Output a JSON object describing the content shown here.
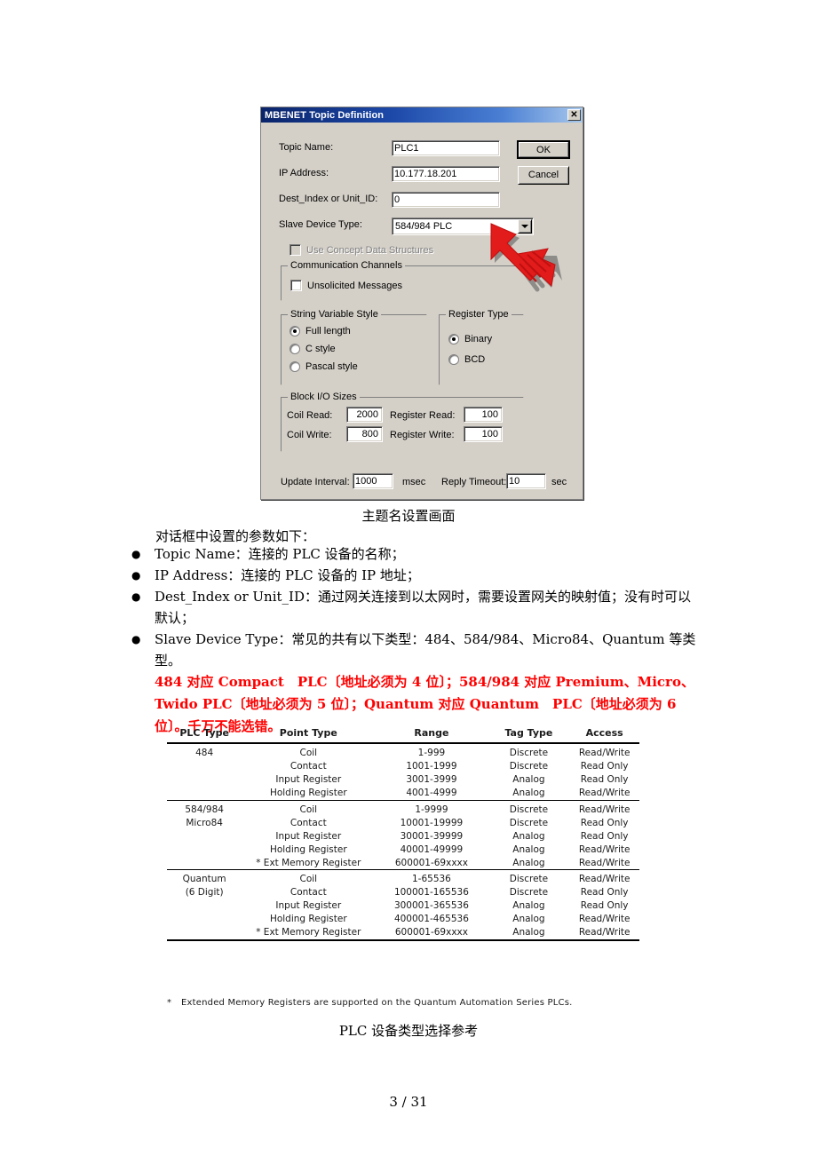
{
  "dialog": {
    "title": "MBENET Topic Definition",
    "close_label": "✕",
    "fields": {
      "topic_name_label": "Topic Name:",
      "topic_name_value": "PLC1",
      "ip_address_label": "IP Address:",
      "ip_address_value": "10.177.18.201",
      "dest_index_label": "Dest_Index or Unit_ID:",
      "dest_index_value": "0",
      "slave_device_label": "Slave Device Type:",
      "slave_device_value": "584/984 PLC"
    },
    "buttons": {
      "ok": "OK",
      "cancel": "Cancel"
    },
    "concept_checkbox": "Use Concept Data Structures",
    "comm_channels": {
      "group_title": "Communication Channels",
      "unsolicited": "Unsolicited Messages"
    },
    "string_style": {
      "group_title": "String Variable Style",
      "options": [
        "Full length",
        "C style",
        "Pascal style"
      ],
      "selected": "Full length"
    },
    "register_type": {
      "group_title": "Register Type",
      "options": [
        "Binary",
        "BCD"
      ],
      "selected": "Binary"
    },
    "block_io": {
      "group_title": "Block I/O Sizes",
      "coil_read_label": "Coil Read:",
      "coil_read_value": "2000",
      "register_read_label": "Register Read:",
      "register_read_value": "100",
      "coil_write_label": "Coil Write:",
      "coil_write_value": "800",
      "register_write_label": "Register Write:",
      "register_write_value": "100"
    },
    "timing": {
      "update_interval_label": "Update Interval:",
      "update_interval_value": "1000",
      "msec_unit": "msec",
      "reply_timeout_label": "Reply Timeout:",
      "reply_timeout_value": "10",
      "sec_unit": "sec"
    }
  },
  "document": {
    "figure_caption_1": "主题名设置画面",
    "intro": "对话框中设置的参数如下：",
    "bullets": [
      "Topic Name：连接的 PLC 设备的名称；",
      "IP Address：连接的 PLC 设备的 IP 地址；",
      "Dest_Index or Unit_ID：通过网关连接到以太网时，需要设置网关的映射值；没有时可以默认；",
      "Slave Device Type：常见的共有以下类型：484、584/984、Micro84、Quantum 等类型。"
    ],
    "red_warning": "484 对应 Compact　PLC〔地址必须为 4 位〕；584/984 对应 Premium、Micro、Twido PLC〔地址必须为 5 位〕；Quantum 对应 Quantum　PLC〔地址必须为 6 位〕。千万不能选错。",
    "figure_caption_2": "PLC  设备类型选择参考",
    "page_number": "3 / 31"
  },
  "table": {
    "headers": [
      "PLC Type",
      "Point Type",
      "Range",
      "Tag Type",
      "Access"
    ],
    "groups": [
      {
        "rows": [
          [
            "484",
            "Coil",
            "1-999",
            "Discrete",
            "Read/Write"
          ],
          [
            "",
            "Contact",
            "1001-1999",
            "Discrete",
            "Read Only"
          ],
          [
            "",
            "Input Register",
            "3001-3999",
            "Analog",
            "Read Only"
          ],
          [
            "",
            "Holding Register",
            "4001-4999",
            "Analog",
            "Read/Write"
          ]
        ]
      },
      {
        "rows": [
          [
            "584/984",
            "Coil",
            "1-9999",
            "Discrete",
            "Read/Write"
          ],
          [
            "Micro84",
            "Contact",
            "10001-19999",
            "Discrete",
            "Read Only"
          ],
          [
            "",
            "Input Register",
            "30001-39999",
            "Analog",
            "Read Only"
          ],
          [
            "",
            "Holding Register",
            "40001-49999",
            "Analog",
            "Read/Write"
          ],
          [
            "",
            "* Ext Memory Register",
            "600001-69xxxx",
            "Analog",
            "Read/Write"
          ]
        ]
      },
      {
        "rows": [
          [
            "Quantum",
            "Coil",
            "1-65536",
            "Discrete",
            "Read/Write"
          ],
          [
            "(6 Digit)",
            "Contact",
            "100001-165536",
            "Discrete",
            "Read Only"
          ],
          [
            "",
            "Input Register",
            "300001-365536",
            "Analog",
            "Read Only"
          ],
          [
            "",
            "Holding Register",
            "400001-465536",
            "Analog",
            "Read/Write"
          ],
          [
            "",
            "* Ext Memory Register",
            "600001-69xxxx",
            "Analog",
            "Read/Write"
          ]
        ]
      }
    ],
    "footnote_marker": "*",
    "footnote": "Extended Memory Registers are supported on the Quantum Automation Series PLCs."
  },
  "colors": {
    "dialog_face": "#d4d0c8",
    "titlebar_start": "#0a246a",
    "warning_red": "#ff0000"
  }
}
